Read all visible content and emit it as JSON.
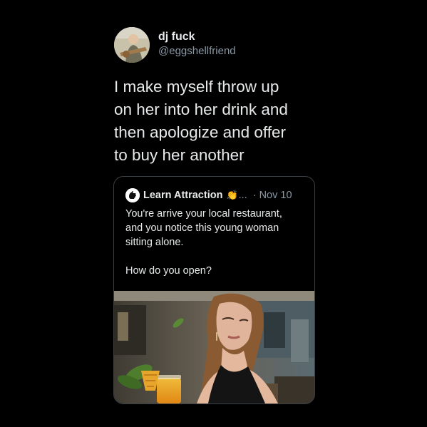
{
  "tweet": {
    "author": {
      "display_name": "dj fuck",
      "handle": "@eggshellfriend"
    },
    "text": "I make myself throw up\non her into her drink and\nthen apologize and offer\nto buy her another"
  },
  "quoted_tweet": {
    "author": {
      "display_name": "Learn Attraction",
      "emoji": "👏",
      "truncation": "...",
      "separator": "·"
    },
    "date": "Nov 10",
    "text": "You're arrive your local restaurant,\nand you notice this young woman\nsitting alone.\n\nHow do you open?",
    "image": {
      "description_icon": "photo-woman-restaurant"
    }
  },
  "colors": {
    "background": "#000000",
    "primary_text": "#e7e9ea",
    "secondary_text": "#8b98a5",
    "card_border": "#3a3f44"
  }
}
